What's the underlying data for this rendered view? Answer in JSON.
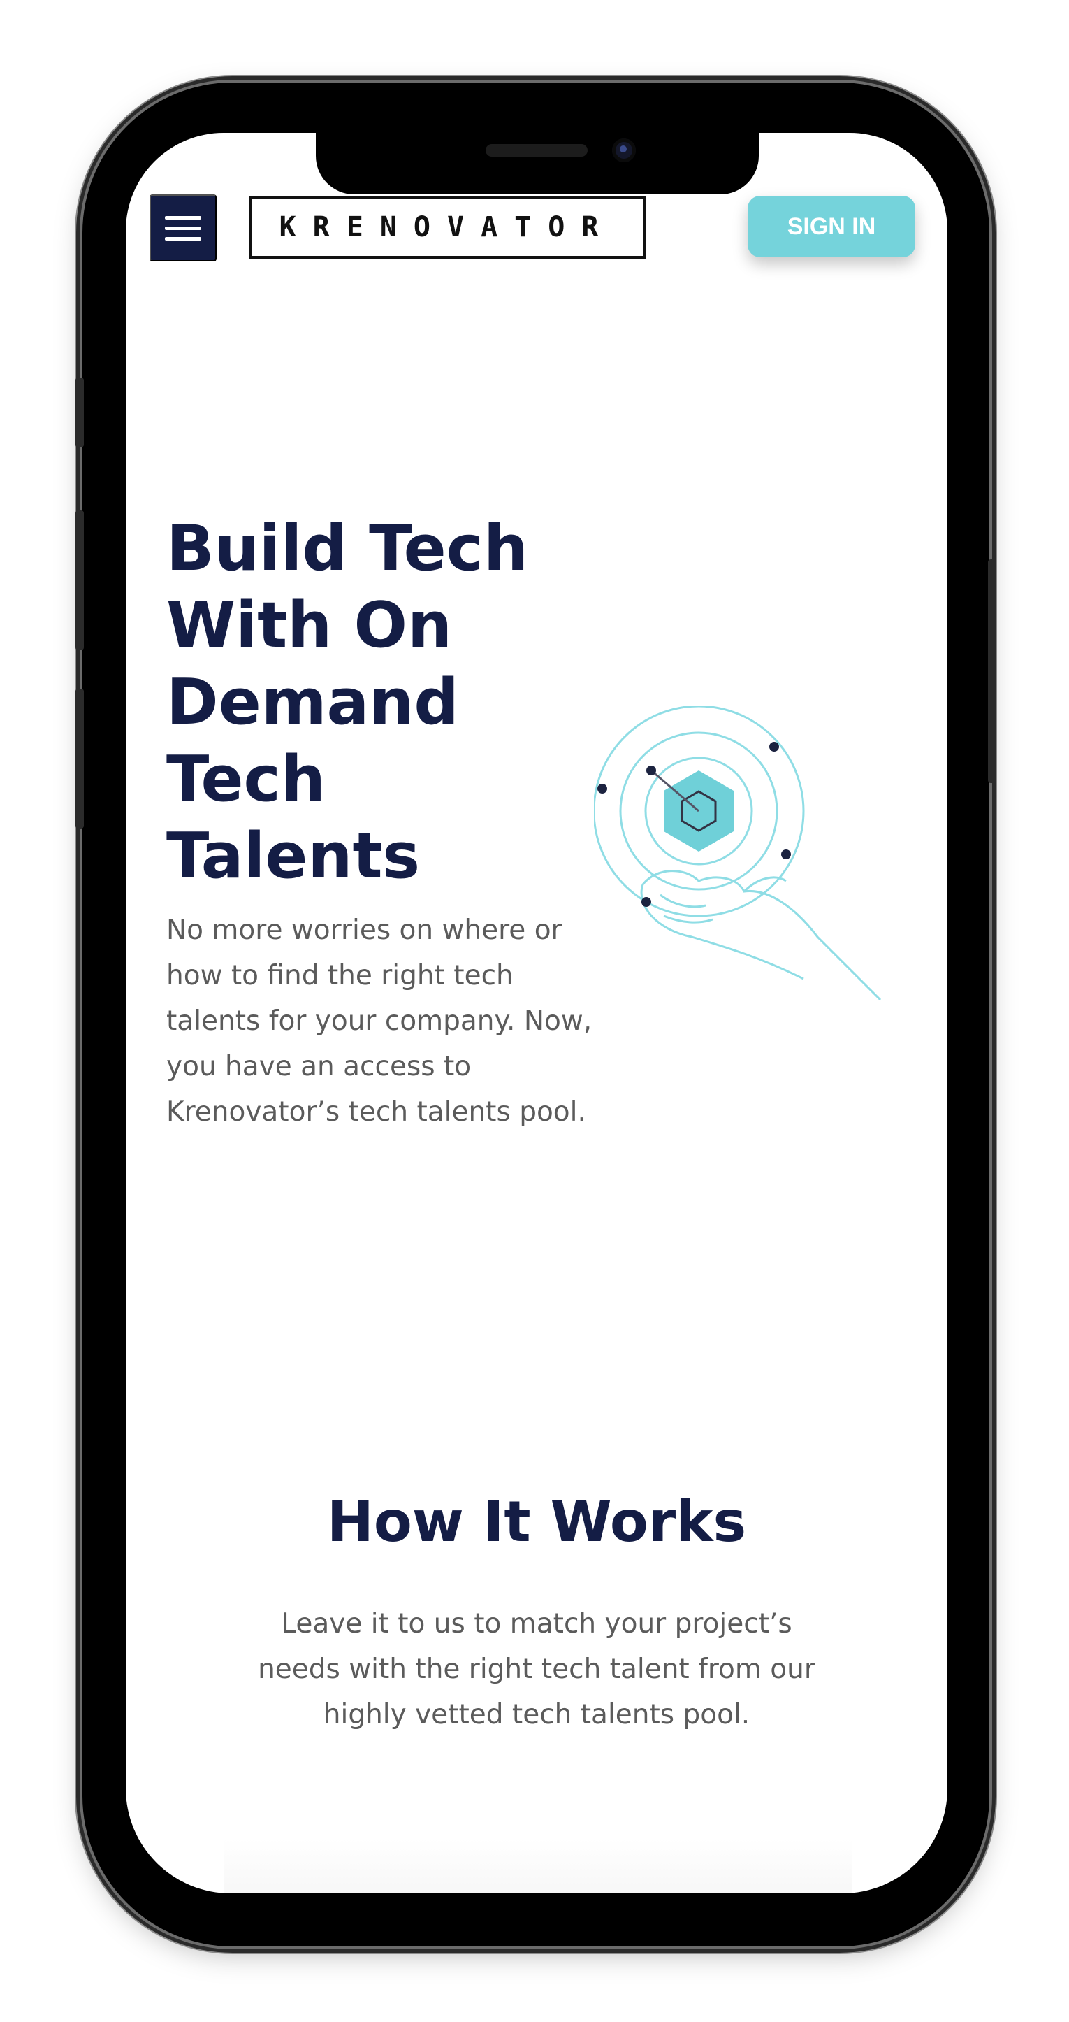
{
  "header": {
    "logo_text": "KRENOVATOR",
    "signin_label": "SIGN IN",
    "accent_color": "#75d3db",
    "brand_color": "#141d45"
  },
  "hero": {
    "title": "Build Tech With On Demand Tech Talents",
    "subtitle": "No more worries on where or how to find the right tech talents for your company. Now, you have an access to Krenovator’s tech talents pool."
  },
  "how_it_works": {
    "title": "How It Works",
    "subtitle": "Leave it to us to match your project’s needs with the right tech talent from our highly vetted tech talents pool."
  },
  "icons": [
    "menu-icon",
    "hand-hexagon-illustration"
  ]
}
